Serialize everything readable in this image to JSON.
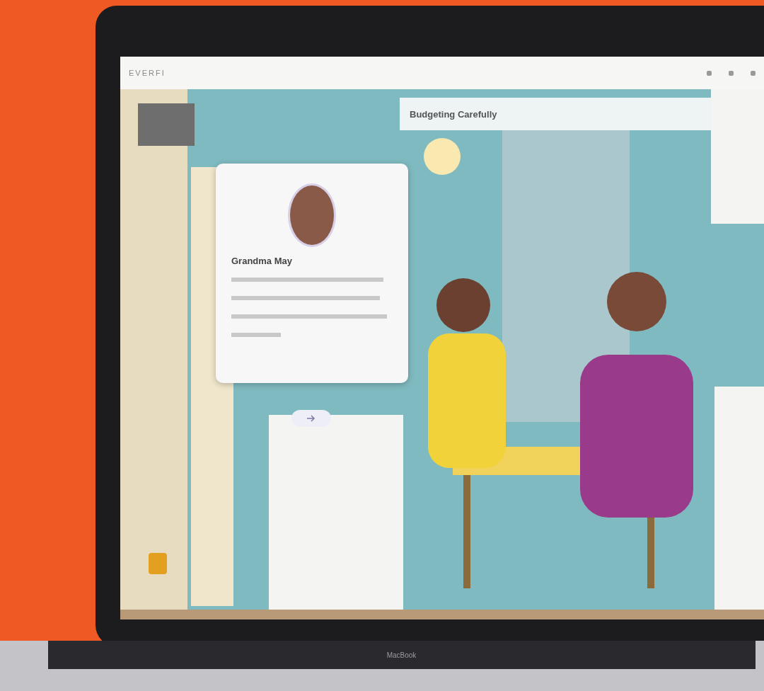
{
  "brand": "EVERFI",
  "lesson": {
    "title": "Budgeting Carefully"
  },
  "dialog": {
    "speaker": "Grandma May"
  },
  "device_label": "MacBook"
}
